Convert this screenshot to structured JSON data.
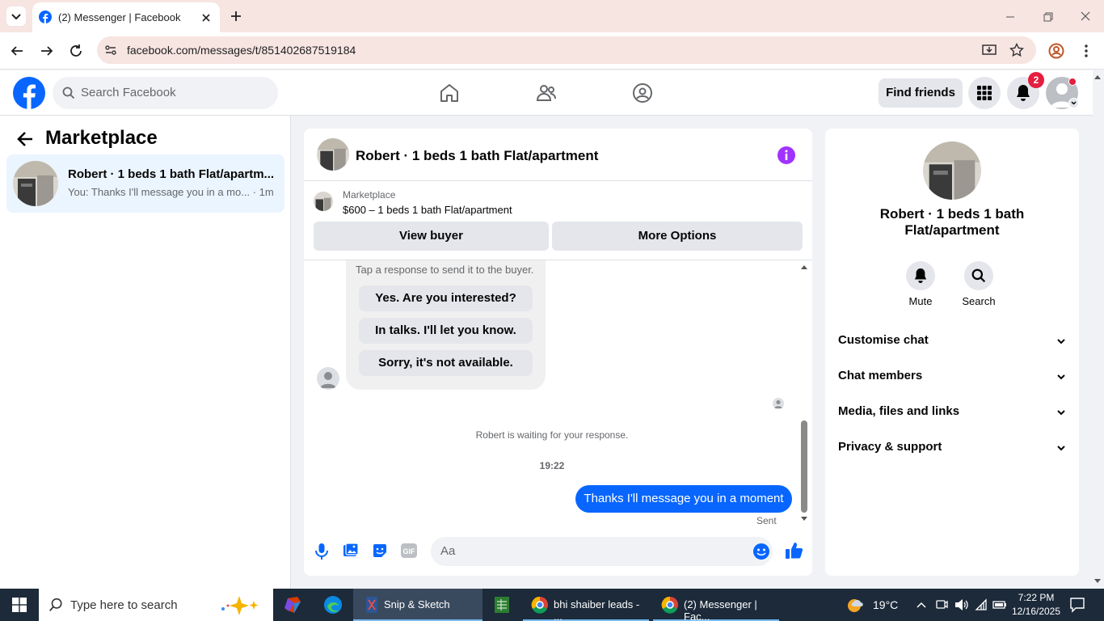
{
  "browser": {
    "tab_title": "(2) Messenger | Facebook",
    "url": "facebook.com/messages/t/851402687519184"
  },
  "fb_header": {
    "search_placeholder": "Search Facebook",
    "find_friends": "Find friends",
    "notification_count": "2"
  },
  "left_panel": {
    "title": "Marketplace",
    "conversation": {
      "title": "Robert · 1 beds 1 bath Flat/apartm...",
      "subtitle": "You: Thanks I'll message you in a mo...",
      "time": "· 1m"
    }
  },
  "chat": {
    "title": "Robert · 1 beds 1 bath Flat/apartment",
    "marketplace_label": "Marketplace",
    "listing": "$600 – 1 beds 1 bath Flat/apartment",
    "view_buyer": "View buyer",
    "more_options": "More Options",
    "quick_reply_hint": "Tap a response to send it to the buyer.",
    "quick_replies": [
      "Yes. Are you interested?",
      "In talks. I'll let you know.",
      "Sorry, it's not available."
    ],
    "waiting_text": "Robert is waiting for your response.",
    "timestamp": "19:22",
    "sent_message": "Thanks I'll message you in a moment",
    "sent_status": "Sent",
    "composer_placeholder": "Aa"
  },
  "right_panel": {
    "name": "Robert · 1 beds 1 bath Flat/apartment",
    "mute": "Mute",
    "search": "Search",
    "sections": [
      "Customise chat",
      "Chat members",
      "Media, files and links",
      "Privacy & support"
    ]
  },
  "taskbar": {
    "search_placeholder": "Type here to search",
    "apps": [
      "Snip & Sketch",
      "bhi shaiber leads - ...",
      "(2) Messenger | Fac..."
    ],
    "weather": "19°C",
    "time": "7:22 PM",
    "date": "12/16/2025"
  },
  "colors": {
    "accent": "#0866ff",
    "purple_info": "#a033ff",
    "badge": "#e41e3f"
  }
}
